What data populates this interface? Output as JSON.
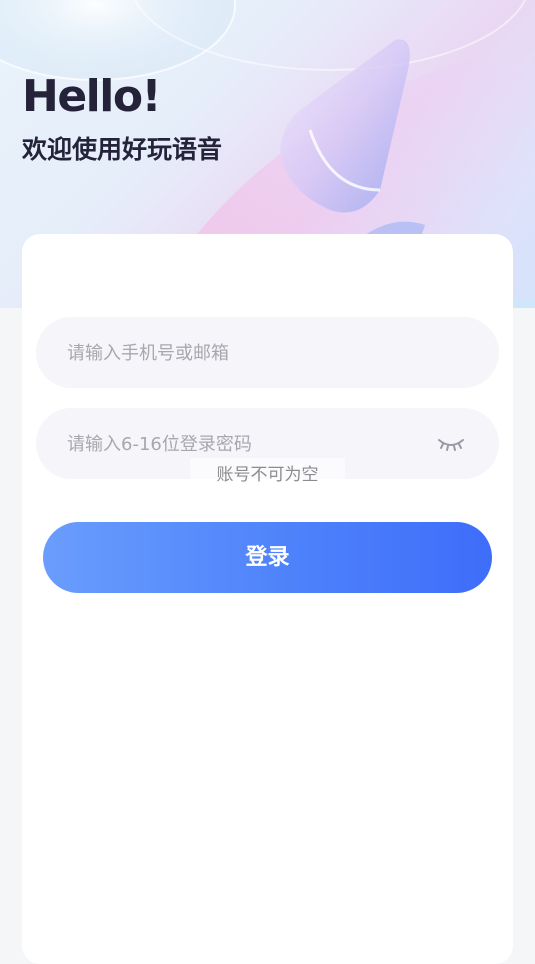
{
  "header": {
    "greeting": "Hello!",
    "welcome": "欢迎使用好玩语音"
  },
  "form": {
    "account_placeholder": "请输入手机号或邮箱",
    "password_placeholder": "请输入6-16位登录密码",
    "password_toggle_icon": "eye-closed-icon",
    "login_label": "登录"
  },
  "toast": {
    "message": "账号不可为空"
  },
  "colors": {
    "accent_start": "#6a9dfc",
    "accent_end": "#3e6dfa",
    "title_text": "#24233a",
    "field_bg": "#f5f5fa"
  }
}
